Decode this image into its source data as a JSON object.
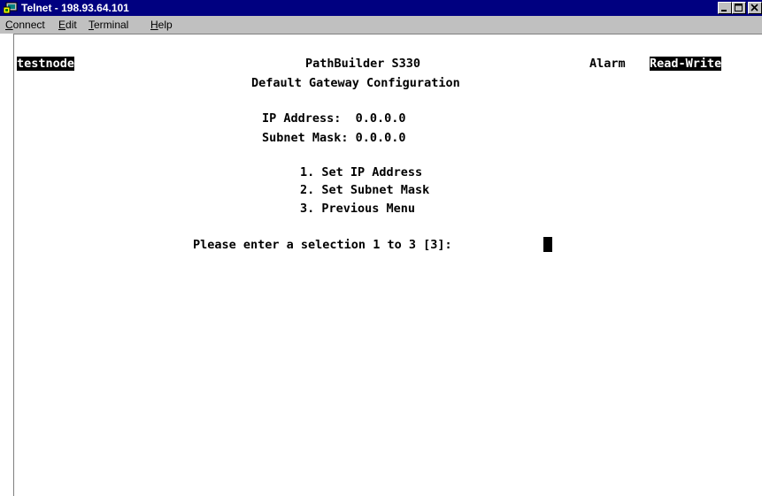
{
  "window": {
    "title": "Telnet - 198.93.64.101"
  },
  "menu": {
    "connect": {
      "accel": "C",
      "rest": "onnect"
    },
    "edit": {
      "accel": "E",
      "rest": "dit"
    },
    "terminal": {
      "accel": "T",
      "rest": "erminal"
    },
    "help": {
      "accel": "H",
      "rest": "elp"
    }
  },
  "terminal": {
    "node_name": "testnode",
    "product": "PathBuilder S330",
    "alarm": "Alarm",
    "access": "Read-Write",
    "screen_title": "Default Gateway Configuration",
    "ip_address_line": "IP Address:  0.0.0.0",
    "subnet_mask_line": "Subnet Mask: 0.0.0.0",
    "options": [
      "1. Set IP Address",
      "2. Set Subnet Mask",
      "3. Previous Menu"
    ],
    "prompt": "Please enter a selection 1 to 3 [3]:"
  }
}
